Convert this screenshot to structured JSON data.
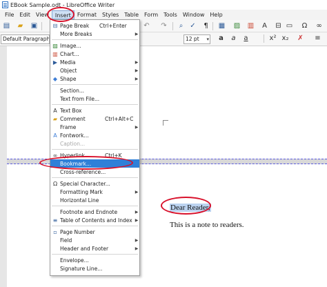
{
  "window": {
    "title": "EBook Sample.odt - LibreOffice Writer"
  },
  "menubar": {
    "items": [
      "File",
      "Edit",
      "View",
      "Insert",
      "Format",
      "Styles",
      "Table",
      "Form",
      "Tools",
      "Window",
      "Help"
    ],
    "active": "Insert"
  },
  "toolbar": {
    "paragraph_style": "Default Paragraph Style",
    "font_size": "12 pt",
    "icons": [
      "new-document-icon",
      "open-icon",
      "save-icon",
      "export-pdf-icon",
      "print-icon",
      "undo-icon",
      "redo-icon",
      "find-replace-icon",
      "spelling-icon",
      "formatting-marks-icon",
      "table-icon",
      "image-icon",
      "chart-icon",
      "special-character-icon",
      "bold-icon",
      "italic-icon",
      "underline-icon",
      "superscript-icon",
      "subscript-icon",
      "clear-formatting-icon"
    ]
  },
  "insert_menu": {
    "items": [
      {
        "label": "Page Break",
        "shortcut": "Ctrl+Enter",
        "icon": "page-break-icon"
      },
      {
        "label": "More Breaks",
        "submenu": true
      },
      {
        "label": "Image...",
        "icon": "image-icon"
      },
      {
        "label": "Chart...",
        "icon": "chart-icon"
      },
      {
        "label": "Media",
        "submenu": true,
        "icon": "media-icon"
      },
      {
        "label": "Object",
        "submenu": true,
        "icon": "object-icon"
      },
      {
        "label": "Shape",
        "submenu": true,
        "icon": "shape-icon"
      },
      {
        "label": "Section...",
        "icon": "section-icon"
      },
      {
        "label": "Text from File...",
        "icon": "text-from-file-icon"
      },
      {
        "label": "Text Box",
        "icon": "text-box-icon"
      },
      {
        "label": "Comment",
        "shortcut": "Ctrl+Alt+C",
        "icon": "comment-icon"
      },
      {
        "label": "Frame",
        "submenu": true
      },
      {
        "label": "Fontwork...",
        "icon": "fontwork-icon"
      },
      {
        "label": "Caption...",
        "disabled": true
      },
      {
        "label": "Hyperlink",
        "shortcut": "Ctrl+K",
        "icon": "hyperlink-icon"
      },
      {
        "label": "Bookmark...",
        "highlighted": true
      },
      {
        "label": "Cross-reference..."
      },
      {
        "label": "Special Character...",
        "icon": "special-character-icon"
      },
      {
        "label": "Formatting Mark",
        "submenu": true
      },
      {
        "label": "Horizontal Line"
      },
      {
        "label": "Footnote and Endnote",
        "submenu": true,
        "icon": "footnote-icon"
      },
      {
        "label": "Table of Contents and Index",
        "submenu": true,
        "icon": "toc-icon"
      },
      {
        "label": "Page Number",
        "icon": "page-number-icon"
      },
      {
        "label": "Field",
        "submenu": true
      },
      {
        "label": "Header and Footer",
        "submenu": true
      },
      {
        "label": "Envelope..."
      },
      {
        "label": "Signature Line..."
      }
    ]
  },
  "document": {
    "selected_text": "Dear Reader,",
    "body_text": "This is a note to readers."
  },
  "annotation_color": "#d8102a",
  "highlight_color": "#2f80d8"
}
